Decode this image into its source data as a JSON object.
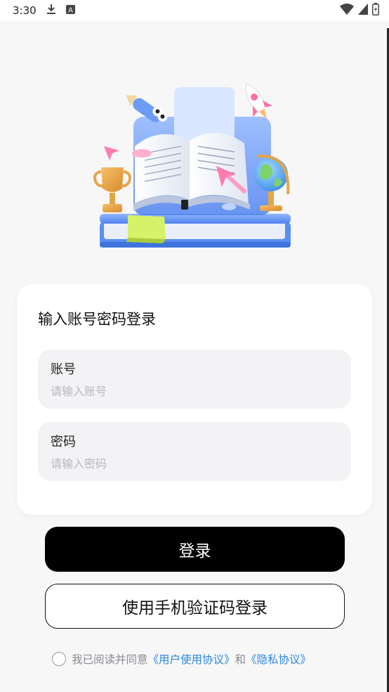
{
  "status": {
    "time": "3:30",
    "icons": [
      "download-icon",
      "a-notification-icon",
      "wifi-icon",
      "signal-icon",
      "battery-icon"
    ]
  },
  "login": {
    "title": "输入账号密码登录",
    "account_label": "账号",
    "account_placeholder": "请输入账号",
    "account_value": "",
    "password_label": "密码",
    "password_placeholder": "请输入密码",
    "password_value": "",
    "submit_label": "登录",
    "sms_label": "使用手机验证码登录"
  },
  "agreement": {
    "prefix": "我已阅读并同意",
    "user_agreement": "《用户使用协议》",
    "conjunction": "和",
    "privacy": "《隐私协议》",
    "checked": false
  },
  "colors": {
    "accent": "#2d86de",
    "primary_button": "#000000",
    "background": "#f7f7f8",
    "card": "#ffffff",
    "field": "#f3f3f5"
  }
}
